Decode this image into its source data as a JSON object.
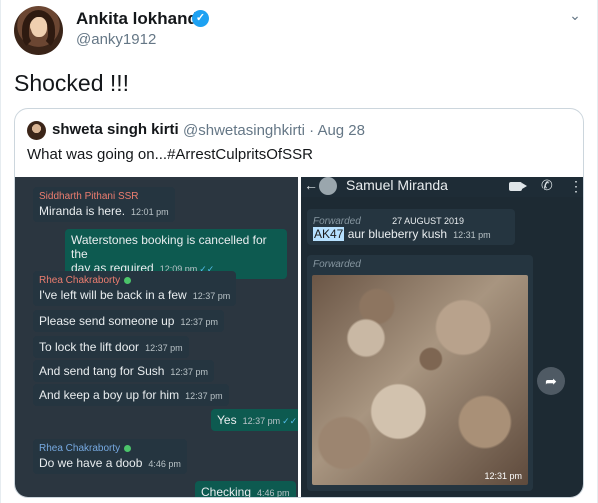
{
  "author": {
    "name": "Ankita lokhande",
    "handle": "@anky1912",
    "verified_glyph": "✓"
  },
  "tweet": {
    "text": "Shocked !!!"
  },
  "menu_glyph": "⌄",
  "quote": {
    "name": "shweta singh kirti",
    "handle": "@shwetasinghkirti · Aug 28",
    "text": "What was going on...#ArrestCulpritsOfSSR"
  },
  "chat_left": {
    "messages": [
      {
        "sender": "Siddharth Pithani SSR",
        "text": "Miranda is here.",
        "time": "12:01 pm",
        "dir": "in"
      },
      {
        "text": "Waterstones booking is cancelled for the",
        "text2": "day as required",
        "time": "12:09 pm",
        "dir": "out",
        "ticks": "✓✓"
      },
      {
        "sender": "Rhea Chakraborty",
        "text": "I've left will be back in a few",
        "time": "12:37 pm",
        "dir": "in"
      },
      {
        "text": "Please send someone up",
        "time": "12:37 pm",
        "dir": "in"
      },
      {
        "text": "To lock the lift door",
        "time": "12:37 pm",
        "dir": "in"
      },
      {
        "text": "And send tang for Sush",
        "time": "12:37 pm",
        "dir": "in"
      },
      {
        "text": "And keep a boy up for him",
        "time": "12:37 pm",
        "dir": "in"
      },
      {
        "text": "Yes",
        "time": "12:37 pm",
        "dir": "out",
        "ticks": "✓✓"
      },
      {
        "sender": "Rhea Chakraborty",
        "text": "Do we have a doob",
        "time": "4:46 pm",
        "dir": "in"
      },
      {
        "text": "Checking",
        "time": "4:46 pm",
        "dir": "out"
      }
    ]
  },
  "chat_right": {
    "contact": "Samuel Miranda",
    "forwarded_label": "Forwarded",
    "date": "27 AUGUST 2019",
    "highlight": "AK47",
    "text": " aur blueberry kush",
    "time": "12:31 pm",
    "photo_time": "12:31 pm",
    "icons": {
      "back": "←",
      "call": "✆",
      "more": "⋮",
      "share": "➦"
    }
  }
}
